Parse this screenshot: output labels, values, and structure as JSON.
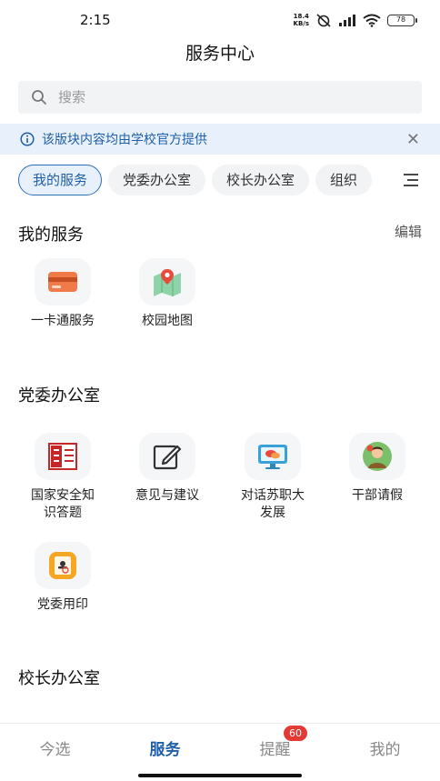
{
  "status_bar": {
    "time": "2:15",
    "net_speed_value": "18.4",
    "net_speed_unit": "KB/s",
    "battery": "78"
  },
  "header": {
    "title": "服务中心"
  },
  "search": {
    "placeholder": "搜索"
  },
  "notice": {
    "text": "该版块内容均由学校官方提供"
  },
  "tabs": [
    {
      "label": "我的服务",
      "active": true
    },
    {
      "label": "党委办公室",
      "active": false
    },
    {
      "label": "校长办公室",
      "active": false
    },
    {
      "label": "组织",
      "active": false
    }
  ],
  "my_services": {
    "title": "我的服务",
    "edit_label": "编辑",
    "items": [
      {
        "label": "一卡通服务",
        "icon": "card-icon"
      },
      {
        "label": "校园地图",
        "icon": "map-icon"
      }
    ]
  },
  "party_office": {
    "title": "党委办公室",
    "items": [
      {
        "label": "国家安全知识答题",
        "icon": "national-security-icon"
      },
      {
        "label": "意见与建议",
        "icon": "edit-icon"
      },
      {
        "label": "对话苏职大发展",
        "icon": "dialogue-monitor-icon"
      },
      {
        "label": "干部请假",
        "icon": "leave-request-icon"
      },
      {
        "label": "党委用印",
        "icon": "seal-icon"
      }
    ]
  },
  "president_office": {
    "title": "校长办公室"
  },
  "bottom_nav": {
    "items": [
      {
        "label": "今选",
        "active": false
      },
      {
        "label": "服务",
        "active": true
      },
      {
        "label": "提醒",
        "active": false,
        "badge": "60"
      },
      {
        "label": "我的",
        "active": false
      }
    ]
  },
  "colors": {
    "accent": "#1f5fa8",
    "notice_bg": "#e8f1fb",
    "badge": "#e53935"
  }
}
